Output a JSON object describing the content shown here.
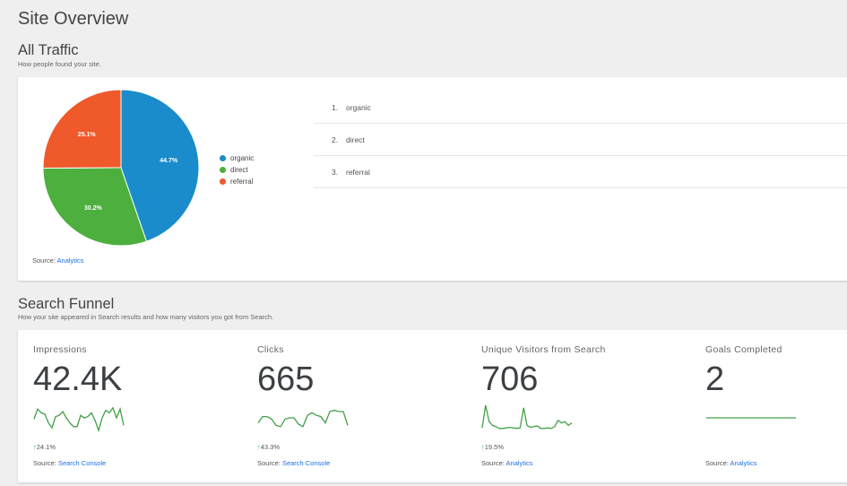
{
  "page_title": "Site Overview",
  "all_traffic": {
    "title": "All Traffic",
    "subtitle": "How people found your site.",
    "chart_data": {
      "type": "pie",
      "slices": [
        {
          "label": "organic",
          "value": 44.7,
          "display": "44.7%",
          "color": "#1a8ccc"
        },
        {
          "label": "direct",
          "value": 30.2,
          "display": "30.2%",
          "color": "#4caf3e"
        },
        {
          "label": "referral",
          "value": 25.1,
          "display": "25.1%",
          "color": "#f0592a"
        }
      ],
      "legend_position": "right"
    },
    "source_label": "Source:",
    "source_link": "Analytics",
    "list": [
      {
        "rank": "1.",
        "label": "organic"
      },
      {
        "rank": "2.",
        "label": "direct"
      },
      {
        "rank": "3.",
        "label": "referral"
      }
    ]
  },
  "search_funnel": {
    "title": "Search Funnel",
    "subtitle": "How your site appeared in Search results and how many visitors you got from Search.",
    "metrics": [
      {
        "label": "Impressions",
        "value": "42.4K",
        "delta": "24.1%",
        "source_label": "Source:",
        "source_link": "Search Console",
        "sparkline": [
          0.45,
          0.85,
          0.7,
          0.65,
          0.3,
          0.1,
          0.55,
          0.6,
          0.75,
          0.5,
          0.3,
          0.15,
          0.15,
          0.6,
          0.5,
          0.55,
          0.7,
          0.4,
          0.0,
          0.5,
          0.8,
          0.7,
          0.9,
          0.5,
          0.85,
          0.2
        ]
      },
      {
        "label": "Clicks",
        "value": "665",
        "delta": "43.3%",
        "source_label": "Source:",
        "source_link": "Search Console",
        "sparkline": [
          0.3,
          0.55,
          0.55,
          0.45,
          0.2,
          0.15,
          0.45,
          0.5,
          0.5,
          0.25,
          0.15,
          0.6,
          0.7,
          0.6,
          0.55,
          0.3,
          0.75,
          0.8,
          0.75,
          0.75,
          0.2
        ]
      },
      {
        "label": "Unique Visitors from Search",
        "value": "706",
        "delta": "19.5%",
        "source_label": "Source:",
        "source_link": "Analytics",
        "sparkline": [
          0.1,
          1.0,
          0.35,
          0.2,
          0.15,
          0.08,
          0.08,
          0.1,
          0.12,
          0.1,
          0.08,
          0.1,
          0.9,
          0.2,
          0.12,
          0.15,
          0.18,
          0.08,
          0.08,
          0.1,
          0.08,
          0.15,
          0.4,
          0.3,
          0.35,
          0.2,
          0.3
        ]
      },
      {
        "label": "Goals Completed",
        "value": "2",
        "delta": "",
        "source_label": "Source:",
        "source_link": "Analytics",
        "sparkline": [
          0.5,
          0.5
        ]
      }
    ]
  },
  "colors": {
    "accent_green": "#34a853",
    "link": "#1a73e8",
    "sparkline": "#43a047"
  }
}
